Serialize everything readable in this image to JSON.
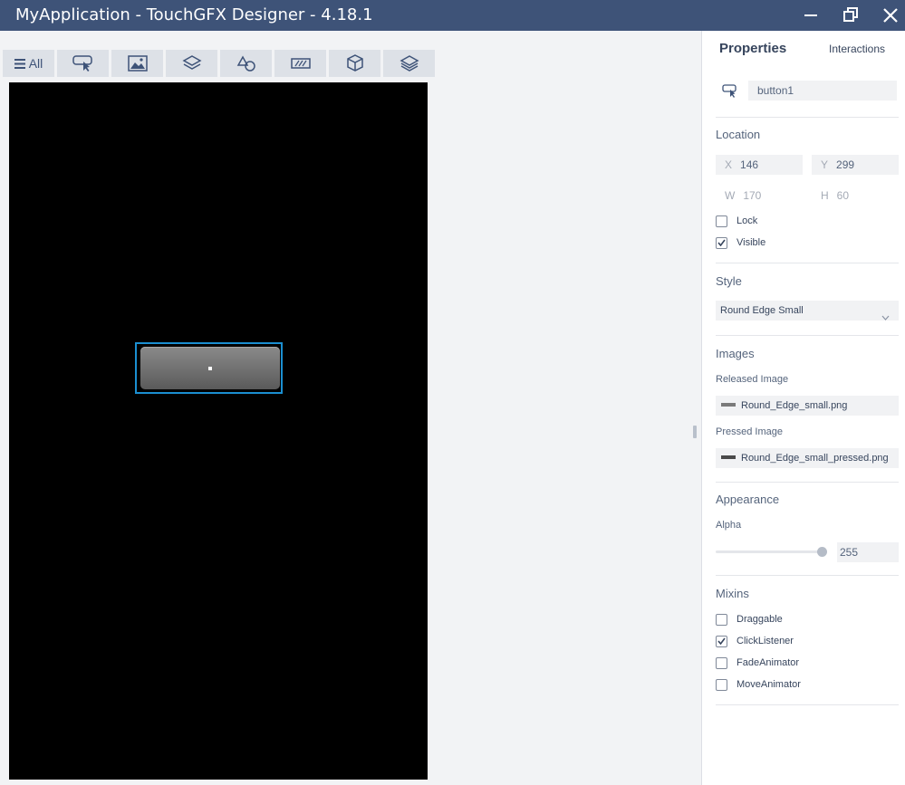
{
  "window": {
    "title": "MyApplication - TouchGFX Designer - 4.18.1",
    "controls": [
      "minimize-icon",
      "restore-icon",
      "close-icon"
    ],
    "titlebar_color": "#3e5378"
  },
  "toolbar": {
    "all_label": "All",
    "buttons": [
      {
        "icon": "menu-icon",
        "label": "All"
      },
      {
        "icon": "button-icon"
      },
      {
        "icon": "image-icon"
      },
      {
        "icon": "container-icon"
      },
      {
        "icon": "shapes-icon"
      },
      {
        "icon": "progress-icon"
      },
      {
        "icon": "3d-box-icon"
      },
      {
        "icon": "layers-icon"
      }
    ]
  },
  "canvas": {
    "screen_color": "#000000",
    "selection_color": "#1b8fd1"
  },
  "properties": {
    "tab_properties": "Properties",
    "tab_interactions": "Interactions",
    "widget_name": "button1",
    "location": {
      "header": "Location",
      "x_label": "X",
      "x": "146",
      "y_label": "Y",
      "y": "299",
      "w_label": "W",
      "w": "170",
      "h_label": "H",
      "h": "60",
      "lock_label": "Lock",
      "lock_checked": false,
      "visible_label": "Visible",
      "visible_checked": true
    },
    "style": {
      "header": "Style",
      "selected": "Round Edge Small"
    },
    "images": {
      "header": "Images",
      "released_label": "Released Image",
      "released_value": "Round_Edge_small.png",
      "pressed_label": "Pressed Image",
      "pressed_value": "Round_Edge_small_pressed.png"
    },
    "appearance": {
      "header": "Appearance",
      "alpha_label": "Alpha",
      "alpha_value": "255",
      "alpha_fraction": 1.0
    },
    "mixins": {
      "header": "Mixins",
      "items": [
        {
          "label": "Draggable",
          "checked": false
        },
        {
          "label": "ClickListener",
          "checked": true
        },
        {
          "label": "FadeAnimator",
          "checked": false
        },
        {
          "label": "MoveAnimator",
          "checked": false
        }
      ]
    }
  }
}
